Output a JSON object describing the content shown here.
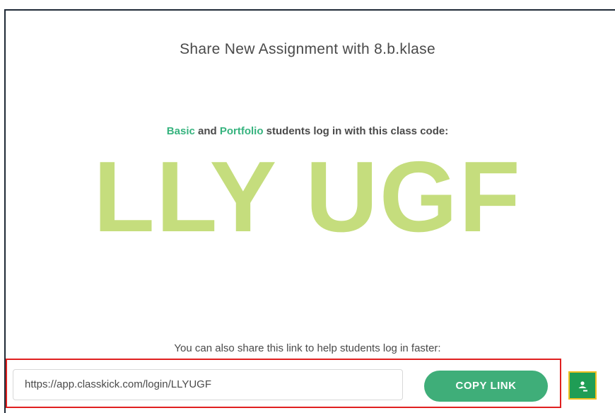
{
  "dialog": {
    "title": "Share New Assignment with 8.b.klase",
    "login": {
      "basic": "Basic",
      "and": " and ",
      "portfolio": "Portfolio",
      "rest": " students log in with this class code:"
    },
    "class_code": "LLY UGF",
    "share_text": "You can also share this link to help students log in faster:",
    "url": "https://app.classkick.com/login/LLYUGF",
    "copy_label": "COPY LINK",
    "icons": {
      "google_classroom": "google-classroom-icon"
    },
    "colors": {
      "accent_green": "#3fae79",
      "tier_green": "#36b37e",
      "code_green": "#c5dd7d",
      "highlight_red": "#e02020",
      "highlight_yellow": "#f0c020"
    }
  }
}
